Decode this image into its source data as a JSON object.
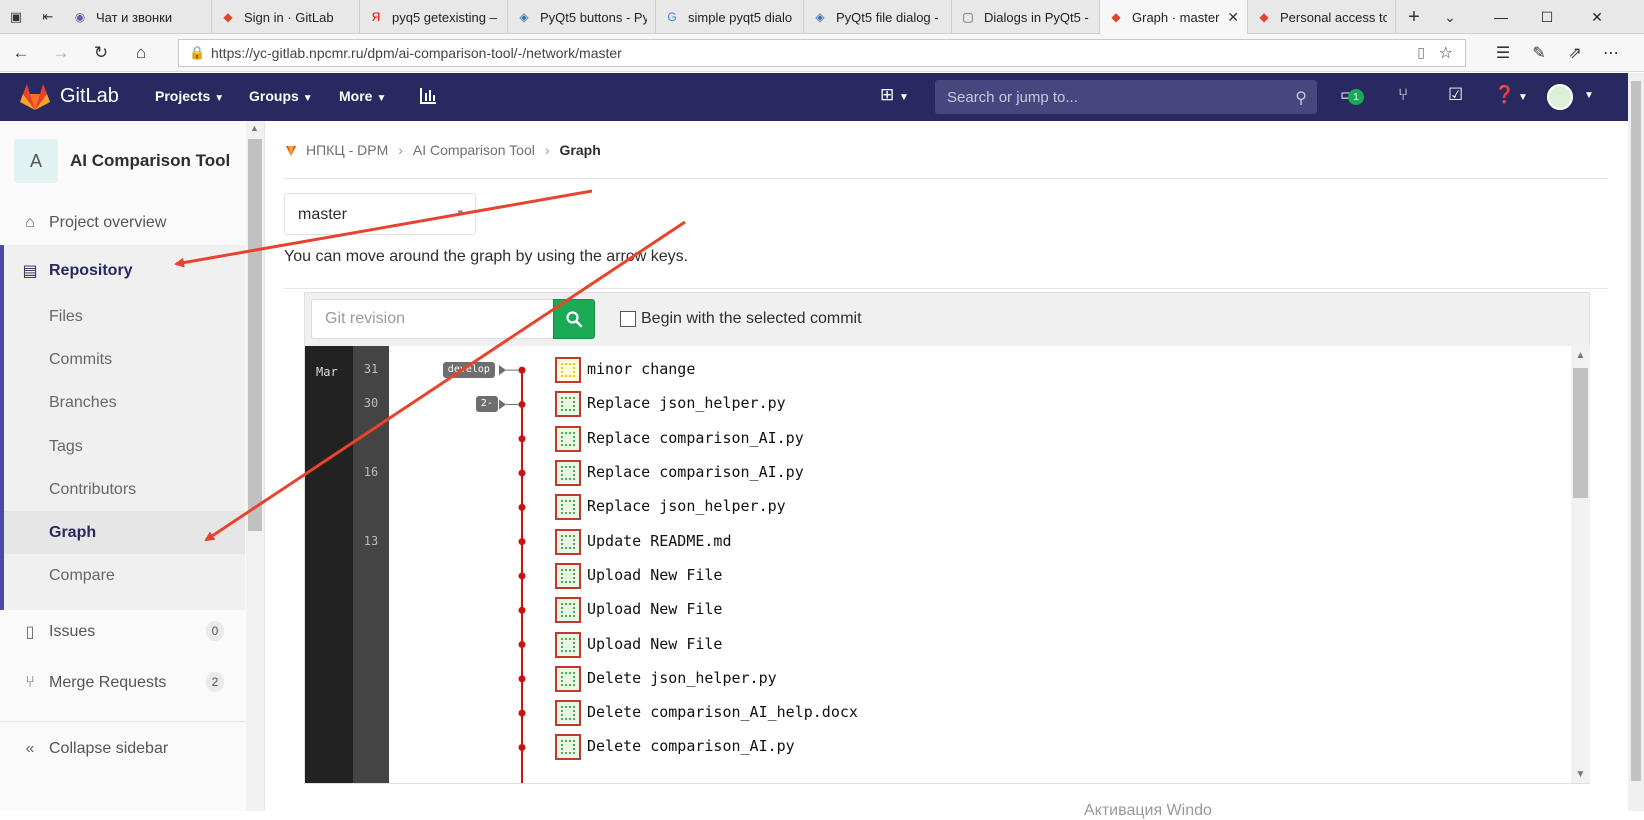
{
  "browser": {
    "tabs": [
      {
        "title": "Чат и звонки",
        "icon": "chat-favicon"
      },
      {
        "title": "Sign in · GitLab",
        "icon": "gitlab-favicon"
      },
      {
        "title": "pyq5 getexisting –",
        "icon": "yandex-favicon"
      },
      {
        "title": "PyQt5 buttons - Py",
        "icon": "python-favicon"
      },
      {
        "title": "simple pyqt5 dialo",
        "icon": "google-favicon"
      },
      {
        "title": "PyQt5 file dialog -",
        "icon": "python-favicon"
      },
      {
        "title": "Dialogs in PyQt5 -",
        "icon": "page-favicon"
      },
      {
        "title": "Graph · master",
        "icon": "gitlab-favicon",
        "active": true
      },
      {
        "title": "Personal access to",
        "icon": "gitlab-favicon"
      }
    ],
    "url": "https://yc-gitlab.npcmr.ru/dpm/ai-comparison-tool/-/network/master"
  },
  "navbar": {
    "brand": "GitLab",
    "menus": [
      "Projects",
      "Groups",
      "More"
    ],
    "search_placeholder": "Search or jump to...",
    "todo_count": "1",
    "colors": {
      "navbar": "#292961",
      "search": "#474780",
      "badge": "#1aaa55"
    }
  },
  "sidebar": {
    "project_initial": "A",
    "project_name": "AI Comparison Tool",
    "overview": "Project overview",
    "repository": "Repository",
    "sub_items": [
      "Files",
      "Commits",
      "Branches",
      "Tags",
      "Contributors",
      "Graph",
      "Compare"
    ],
    "active_sub": "Graph",
    "issues": {
      "label": "Issues",
      "count": "0"
    },
    "merge_requests": {
      "label": "Merge Requests",
      "count": "2"
    },
    "collapse": "Collapse sidebar"
  },
  "breadcrumb": {
    "group": "НПКЦ - DPM",
    "project": "AI Comparison Tool",
    "current": "Graph"
  },
  "main": {
    "ref": "master",
    "hint": "You can move around the graph by using the arrow keys.",
    "revision_placeholder": "Git revision",
    "begin_label": "Begin with the selected commit"
  },
  "graph": {
    "month": "Mar",
    "days": [
      {
        "row": 0,
        "day": "31"
      },
      {
        "row": 1,
        "day": "30"
      },
      {
        "row": 3,
        "day": "16"
      },
      {
        "row": 5,
        "day": "13"
      }
    ],
    "tags": [
      {
        "row": 0,
        "label": "develop"
      },
      {
        "row": 1,
        "label": "2-"
      }
    ],
    "commits": [
      "minor change",
      "Replace json_helper.py",
      "Replace comparison_AI.py",
      "Replace comparison_AI.py",
      "Replace json_helper.py",
      "Update README.md",
      "Upload New File",
      "Upload New File",
      "Upload New File",
      "Delete json_helper.py",
      "Delete comparison_AI_help.docx",
      "Delete comparison_AI.py"
    ],
    "line_color": "#cc1111"
  },
  "watermark": "Активация Windo"
}
